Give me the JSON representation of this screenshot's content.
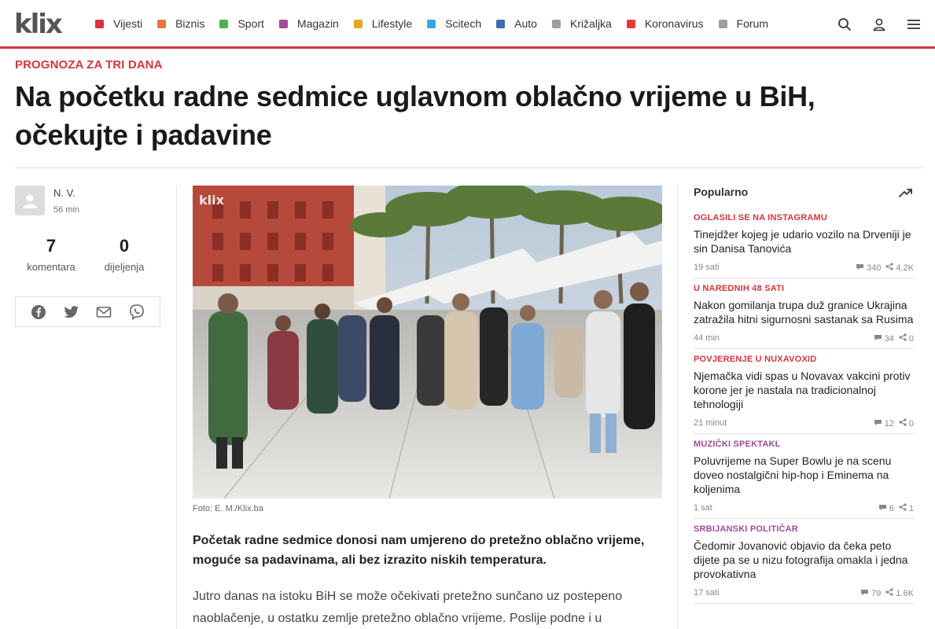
{
  "brand": {
    "logo_text": "klix"
  },
  "nav": [
    {
      "label": "Vijesti",
      "color": "#d8343d"
    },
    {
      "label": "Biznis",
      "color": "#e8773a"
    },
    {
      "label": "Sport",
      "color": "#4caf50"
    },
    {
      "label": "Magazin",
      "color": "#a04c9c"
    },
    {
      "label": "Lifestyle",
      "color": "#e5a91a"
    },
    {
      "label": "Scitech",
      "color": "#3aa7e0"
    },
    {
      "label": "Auto",
      "color": "#3d6cb3"
    },
    {
      "label": "Križaljka",
      "color": "#9aa0a6"
    },
    {
      "label": "Koronavirus",
      "color": "#e53935"
    },
    {
      "label": "Forum",
      "color": "#9aa0a6"
    }
  ],
  "top_icons": [
    "search-icon",
    "user-icon",
    "menu-icon"
  ],
  "article": {
    "kicker": "PROGNOZA ZA TRI DANA",
    "title": "Na početku radne sedmice uglavnom oblačno vrijeme u BiH, očekujte i padavine",
    "author": "N. V.",
    "time": "56 min",
    "comments_count": "7",
    "comments_label": "komentara",
    "shares_count": "0",
    "shares_label": "dijeljenja",
    "share_icons": [
      "facebook-icon",
      "twitter-icon",
      "email-icon",
      "viber-icon"
    ],
    "photo_watermark": "klix",
    "photo_credit": "Foto: E. M./Klix.ba",
    "lead": "Početak radne sedmice donosi nam umjereno do pretežno oblačno vrijeme, moguće sa padavinama, ali bez izrazito niskih temperatura.",
    "body": "Jutro danas na istoku BiH se može očekivati pretežno sunčano uz postepeno naoblačenje, u ostatku zemlje pretežno oblačno vrijeme. Poslije podne i u"
  },
  "sidebar": {
    "title": "Popularno",
    "items": [
      {
        "kicker": "OGLASILI SE NA INSTAGRAMU",
        "kicker_color": "#d8343d",
        "headline": "Tinejdžer kojeg je udario vozilo na Drveniji je sin Danisa Tanovića",
        "time": "19 sati",
        "comments": "340",
        "shares": "4.2K"
      },
      {
        "kicker": "U NAREDNIH 48 SATI",
        "kicker_color": "#d8343d",
        "headline": "Nakon gomilanja trupa duž granice Ukrajina zatražila hitni sigurnosni sastanak sa Rusima",
        "time": "44 min",
        "comments": "34",
        "shares": "0"
      },
      {
        "kicker": "POVJERENJE U NUXAVOXID",
        "kicker_color": "#d8343d",
        "headline": "Njemačka vidi spas u Novavax vakcini protiv korone jer je nastala na tradicionalnoj tehnologiji",
        "time": "21 minut",
        "comments": "12",
        "shares": "0"
      },
      {
        "kicker": "MUZIČKI SPEKTAKL",
        "kicker_color": "#a04c9c",
        "headline": "Poluvrijeme na Super Bowlu je na scenu doveo nostalgični hip-hop i Eminema na koljenima",
        "time": "1 sat",
        "comments": "6",
        "shares": "1"
      },
      {
        "kicker": "SRBIJANSKI POLITIČAR",
        "kicker_color": "#a04c9c",
        "headline": "Čedomir Jovanović objavio da čeka peto dijete pa se u nizu fotografija omakla i jedna provokativna",
        "time": "17 sati",
        "comments": "79",
        "shares": "1.6K"
      }
    ]
  }
}
